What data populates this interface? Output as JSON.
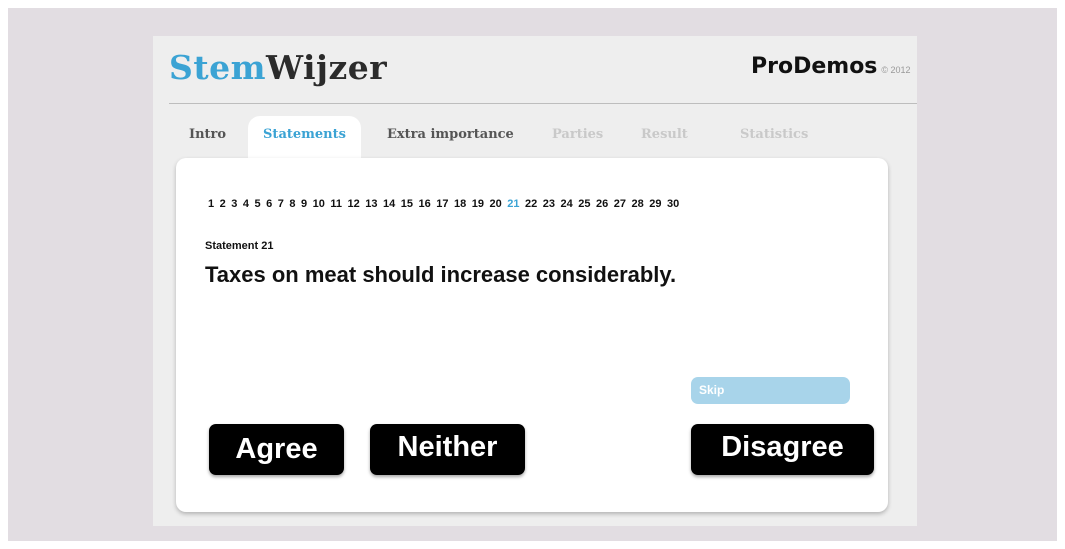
{
  "header": {
    "logo_part1": "Stem",
    "logo_part2": "Wijzer",
    "brand_name": "ProDemos",
    "brand_copyright": "© 2012"
  },
  "tabs": [
    {
      "label": "Intro",
      "state": "done"
    },
    {
      "label": "Statements",
      "state": "active"
    },
    {
      "label": "Extra importance",
      "state": "done"
    },
    {
      "label": "Parties",
      "state": "inactive"
    },
    {
      "label": "Result",
      "state": "inactive"
    },
    {
      "label": "Statistics",
      "state": "inactive"
    }
  ],
  "pager": {
    "pages": [
      "1",
      "2",
      "3",
      "4",
      "5",
      "6",
      "7",
      "8",
      "9",
      "10",
      "11",
      "12",
      "13",
      "14",
      "15",
      "16",
      "17",
      "18",
      "19",
      "20",
      "21",
      "22",
      "23",
      "24",
      "25",
      "26",
      "27",
      "28",
      "29",
      "30"
    ],
    "current": "21"
  },
  "statement": {
    "label": "Statement 21",
    "text": "Taxes on meat should increase considerably."
  },
  "actions": {
    "skip": "Skip",
    "agree": "Agree",
    "neither": "Neither",
    "disagree": "Disagree"
  },
  "colors": {
    "accent": "#3ba3d4",
    "skip_bg": "#a8d4ea",
    "backdrop": "#e2dde2"
  }
}
